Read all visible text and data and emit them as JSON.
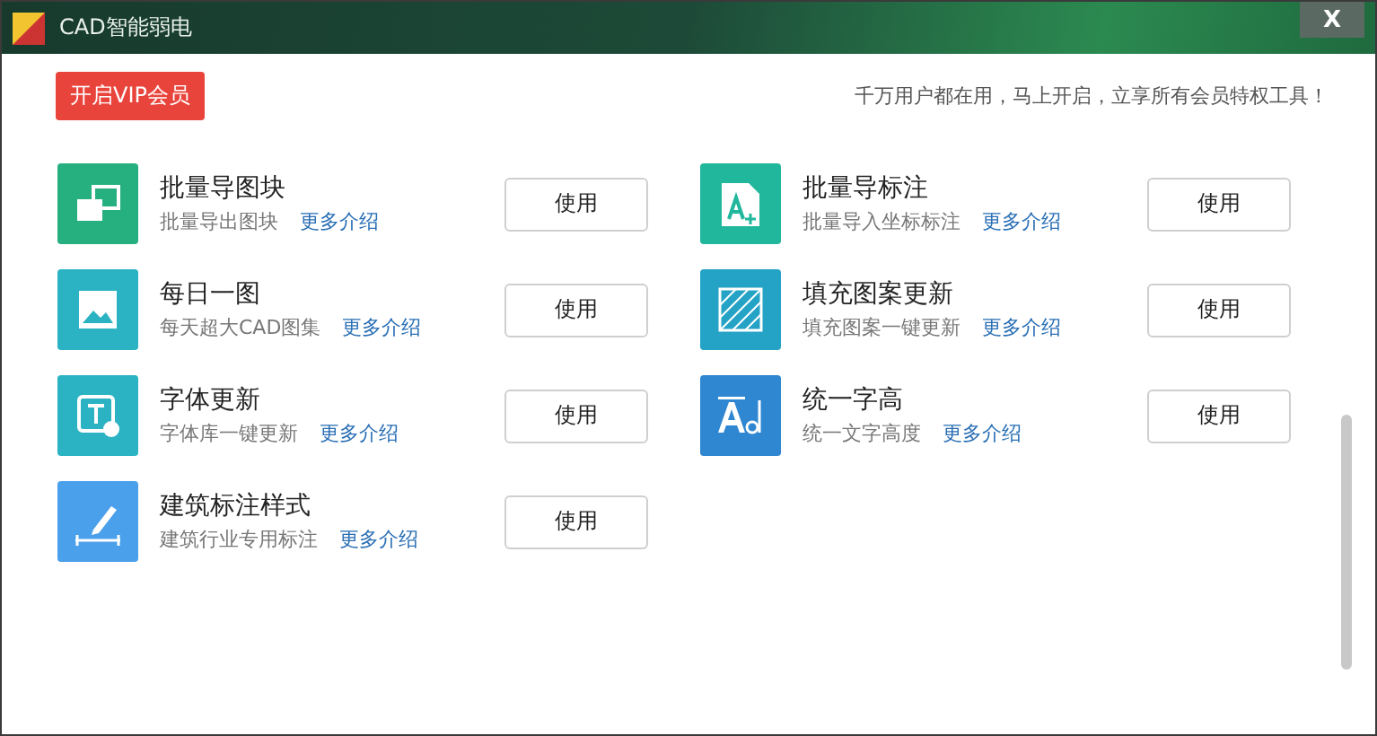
{
  "window": {
    "title": "CAD智能弱电",
    "close": "X"
  },
  "vip_button": "开启VIP会员",
  "tagline": "千万用户都在用，马上开启，立享所有会员特权工具！",
  "tools": [
    {
      "name": "批量导图块",
      "desc": "批量导出图块",
      "more": "更多介绍",
      "action": "使用"
    },
    {
      "name": "批量导标注",
      "desc": "批量导入坐标标注",
      "more": "更多介绍",
      "action": "使用"
    },
    {
      "name": "每日一图",
      "desc": "每天超大CAD图集",
      "more": "更多介绍",
      "action": "使用"
    },
    {
      "name": "填充图案更新",
      "desc": "填充图案一键更新",
      "more": "更多介绍",
      "action": "使用"
    },
    {
      "name": "字体更新",
      "desc": "字体库一键更新",
      "more": "更多介绍",
      "action": "使用"
    },
    {
      "name": "统一字高",
      "desc": "统一文字高度",
      "more": "更多介绍",
      "action": "使用"
    },
    {
      "name": "建筑标注样式",
      "desc": "建筑行业专用标注",
      "more": "更多介绍",
      "action": "使用"
    }
  ]
}
